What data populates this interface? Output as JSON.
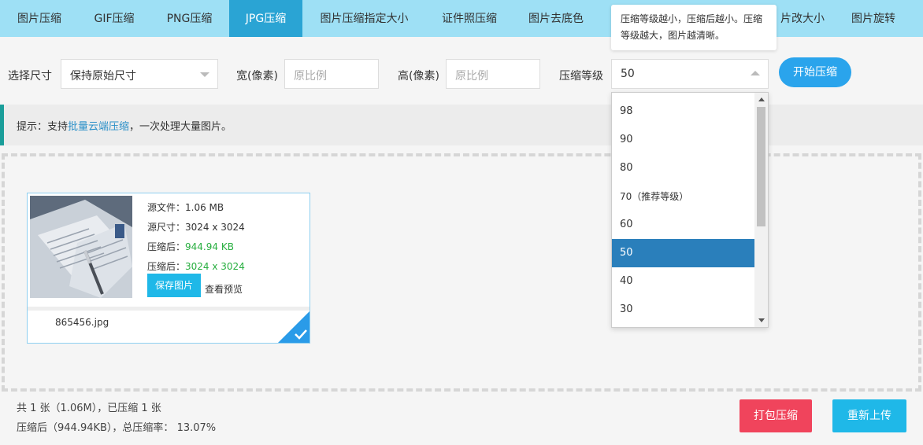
{
  "tabs": [
    {
      "label": "图片压缩",
      "active": false
    },
    {
      "label": "GIF压缩",
      "active": false
    },
    {
      "label": "PNG压缩",
      "active": false
    },
    {
      "label": "JPG压缩",
      "active": true
    },
    {
      "label": "图片压缩指定大小",
      "active": false
    },
    {
      "label": "证件照压缩",
      "active": false
    },
    {
      "label": "图片去底色",
      "active": false
    },
    {
      "label": "片改大小",
      "active": false
    },
    {
      "label": "图片旋转",
      "active": false
    }
  ],
  "tooltip": {
    "text": "压缩等级越小，压缩后越小。压缩等级越大，图片越清晰。"
  },
  "controls": {
    "size_label": "选择尺寸",
    "size_value": "保持原始尺寸",
    "width_label": "宽(像素)",
    "width_placeholder": "原比例",
    "height_label": "高(像素)",
    "height_placeholder": "原比例",
    "level_label": "压缩等级",
    "level_value": "50",
    "start_button": "开始压缩"
  },
  "tip": {
    "prefix": "提示：支持",
    "link": "批量云端压缩",
    "suffix": "，一次处理大量图片。"
  },
  "card": {
    "source_file": "源文件：1.06 MB",
    "source_size": "源尺寸：3024 x 3024",
    "compressed_size_label": "压缩后：",
    "compressed_size_value": "944.94 KB",
    "compressed_dim_label": "压缩后：",
    "compressed_dim_value": "3024 x 3024",
    "save_button": "保存图片",
    "preview_link": "查看预览",
    "filename": "865456.jpg"
  },
  "dropdown": {
    "options": [
      {
        "label": "98",
        "selected": false
      },
      {
        "label": "90",
        "selected": false
      },
      {
        "label": "80",
        "selected": false
      },
      {
        "label": "70（推荐等级）",
        "selected": false
      },
      {
        "label": "60",
        "selected": false
      },
      {
        "label": "50",
        "selected": true
      },
      {
        "label": "40",
        "selected": false
      },
      {
        "label": "30",
        "selected": false
      }
    ]
  },
  "footer": {
    "line1": "共 1 张（1.06M），已压缩 1 张",
    "line2": "压缩后（944.94KB），总压缩率： 13.07%",
    "pack_button": "打包压缩",
    "reupload_button": "重新上传"
  },
  "colors": {
    "tabbar": "#9ee0f5",
    "active_tab": "#2aa4d4",
    "primary": "#2aa4ec",
    "danger": "#f0445c",
    "success": "#27ae3f",
    "selected_option": "#2a7fbb"
  }
}
